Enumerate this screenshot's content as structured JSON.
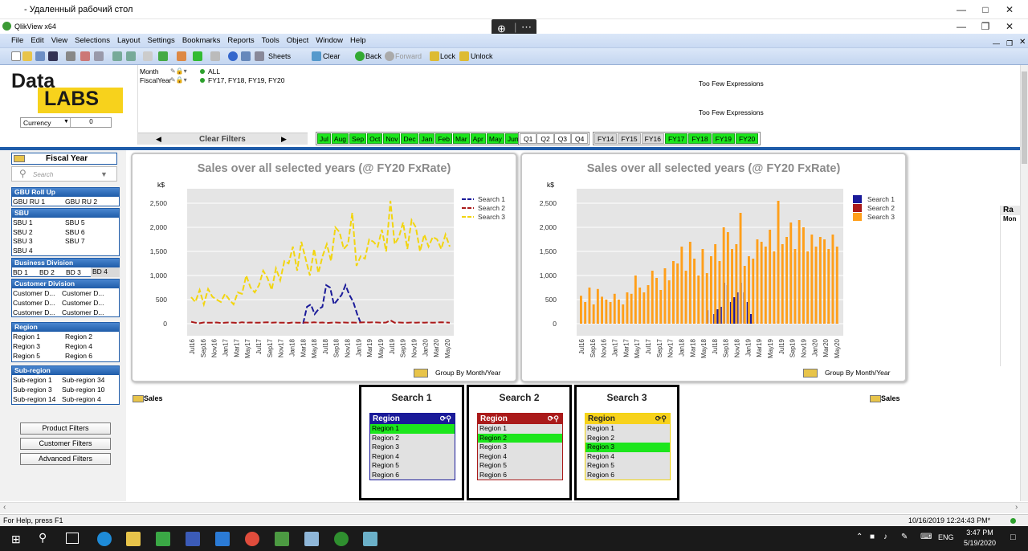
{
  "rdp": {
    "title": " - Удаленный рабочий стол"
  },
  "app": {
    "title": "QlikView x64"
  },
  "menu": [
    "File",
    "Edit",
    "View",
    "Selections",
    "Layout",
    "Settings",
    "Bookmarks",
    "Reports",
    "Tools",
    "Object",
    "Window",
    "Help"
  ],
  "toolbar": {
    "sheets": "Sheets",
    "clear": "Clear",
    "back": "Back",
    "forward": "Forward",
    "lock": "Lock",
    "unlock": "Unlock"
  },
  "logo": {
    "top": "Data",
    "bottom": "LABS"
  },
  "currency": {
    "label": "Currency",
    "value": "0"
  },
  "current_selections": [
    {
      "field": "Month",
      "value": "ALL"
    },
    {
      "field": "FiscalYear",
      "value": "FY17, FY18, FY19, FY20"
    }
  ],
  "clear_filters": "Clear Filters",
  "too_few": [
    "Too Few Expressions",
    "Too Few Expressions"
  ],
  "months": [
    "Jul",
    "Aug",
    "Sep",
    "Oct",
    "Nov",
    "Dec",
    "Jan",
    "Feb",
    "Mar",
    "Apr",
    "May",
    "Jun"
  ],
  "quarters": [
    "Q1",
    "Q2",
    "Q3",
    "Q4"
  ],
  "fiscal_years": [
    "FY14",
    "FY15",
    "FY16",
    "FY17",
    "FY18",
    "FY19",
    "FY20"
  ],
  "left": {
    "fiscal_year_title": "Fiscal Year",
    "search_placeholder": "Search",
    "gbu": {
      "title": "GBU Roll Up",
      "items": [
        "GBU RU 1",
        "GBU RU 2"
      ]
    },
    "sbu": {
      "title": "SBU",
      "items": [
        "SBU 1",
        "SBU 5",
        "SBU 2",
        "SBU 6",
        "SBU 3",
        "SBU 7",
        "SBU 4"
      ]
    },
    "bd": {
      "title": "Business Division",
      "items": [
        "BD 1",
        "BD 2",
        "BD 3",
        "BD 4"
      ]
    },
    "cd": {
      "title": "Customer Division",
      "items": [
        "Customer D...",
        "Customer D...",
        "Customer D...",
        "Customer D...",
        "Customer D...",
        "Customer D..."
      ]
    },
    "region": {
      "title": "Region",
      "items": [
        "Region 1",
        "Region 2",
        "Region 3",
        "Region 4",
        "Region 5",
        "Region 6"
      ]
    },
    "subregion": {
      "title": "Sub-region",
      "items": [
        "Sub-region 1",
        "Sub-region 34",
        "Sub-region 3",
        "Sub-region 10",
        "Sub-region 14",
        "Sub-region 4"
      ]
    },
    "buttons": [
      "Product Filters",
      "Customer Filters",
      "Advanced Filters"
    ]
  },
  "charts": {
    "title": "Sales over all selected years (@ FY20 FxRate)",
    "unit": "k$",
    "group_by": "Group By Month/Year",
    "sales_label": "Sales",
    "colors": {
      "s1": "#1a1a99",
      "s2": "#aa1a1a",
      "s3_line": "#f2d50f",
      "s3_bar": "#ff9f1a"
    }
  },
  "chart_data": [
    {
      "type": "line",
      "title": "Sales over all selected years (@ FY20 FxRate)",
      "ylabel": "k$",
      "ylim": [
        -250,
        2800
      ],
      "yticks": [
        "2,500",
        "2,000",
        "1,500",
        "1,000",
        "500",
        "0"
      ],
      "xticklabels": [
        "Jul16",
        "Sep16",
        "Nov16",
        "Jan17",
        "Mar17",
        "May17",
        "Jul17",
        "Sep17",
        "Nov17",
        "Jan18",
        "Mar18",
        "May18",
        "Jul18",
        "Sep18",
        "Nov18",
        "Jan19",
        "Mar19",
        "May19",
        "Jul19",
        "Sep19",
        "Nov19",
        "Jan20",
        "Mar20",
        "May20"
      ],
      "series": [
        {
          "name": "Search 1",
          "values": [
            0,
            0,
            0,
            0,
            0,
            0,
            0,
            0,
            0,
            0,
            0,
            0,
            0,
            0,
            0,
            0,
            0,
            0,
            0,
            0,
            0,
            0,
            0,
            0,
            0,
            0,
            0,
            0,
            0,
            0,
            350,
            400,
            200,
            300,
            350,
            800,
            750,
            400,
            500,
            600,
            800,
            600,
            450,
            200,
            0,
            0,
            0,
            0,
            0,
            0,
            0,
            0,
            0,
            0,
            0,
            0,
            0,
            0,
            0,
            0,
            0,
            0,
            0,
            0,
            0,
            0,
            0,
            0
          ]
        },
        {
          "name": "Search 2",
          "values": [
            40,
            20,
            10,
            25,
            20,
            20,
            25,
            15,
            20,
            25,
            20,
            15,
            30,
            20,
            25,
            20,
            20,
            25,
            30,
            20,
            25,
            20,
            20,
            15,
            25,
            20,
            20,
            25,
            20,
            30,
            20,
            25,
            15,
            20,
            25,
            20,
            25,
            20,
            25,
            20,
            25,
            30,
            25,
            30,
            25,
            20,
            25,
            70,
            20,
            25,
            20,
            20,
            25,
            20,
            25,
            20,
            25,
            20,
            25,
            30,
            25,
            20
          ]
        },
        {
          "name": "Search 3",
          "values": [
            550,
            450,
            700,
            400,
            720,
            560,
            500,
            450,
            620,
            500,
            400,
            650,
            620,
            1000,
            750,
            650,
            800,
            1100,
            950,
            700,
            1150,
            900,
            1300,
            1250,
            1600,
            1100,
            1700,
            1350,
            1000,
            1550,
            1050,
            1400,
            1650,
            1300,
            2000,
            1900,
            1550,
            1650,
            2300,
            1200,
            1400,
            1350,
            1750,
            1700,
            1600,
            1950,
            1500,
            2550,
            1650,
            1800,
            2100,
            1550,
            2150,
            2000,
            1500,
            1850,
            1600,
            1800,
            1750,
            1550,
            1850,
            1600
          ]
        }
      ]
    },
    {
      "type": "bar",
      "title": "Sales over all selected years (@ FY20 FxRate)",
      "ylabel": "k$",
      "ylim": [
        -250,
        2800
      ],
      "yticks": [
        "2,500",
        "2,000",
        "1,500",
        "1,000",
        "500",
        "0"
      ],
      "xticklabels": [
        "Jul16",
        "Sep16",
        "Nov16",
        "Jan17",
        "Mar17",
        "May17",
        "Jul17",
        "Sep17",
        "Nov17",
        "Jan18",
        "Mar18",
        "May18",
        "Jul18",
        "Sep18",
        "Nov18",
        "Jan19",
        "Mar19",
        "May19",
        "Jul19",
        "Sep19",
        "Nov19",
        "Jan20",
        "Mar20",
        "May20"
      ],
      "series": [
        {
          "name": "Search 1",
          "values": [
            0,
            0,
            0,
            0,
            0,
            0,
            0,
            0,
            0,
            0,
            0,
            0,
            0,
            0,
            0,
            0,
            0,
            0,
            0,
            0,
            0,
            0,
            0,
            0,
            0,
            0,
            0,
            0,
            0,
            0,
            0,
            0,
            0,
            0,
            0,
            0,
            0,
            0,
            280,
            380,
            200,
            300,
            350,
            850,
            800,
            450,
            550,
            650,
            850,
            650,
            450,
            200,
            0,
            0,
            0,
            0,
            0,
            0,
            0,
            0,
            0,
            0,
            0,
            0,
            0,
            0,
            0,
            0,
            0,
            0,
            0,
            0,
            0,
            0,
            0,
            0,
            0,
            0
          ]
        },
        {
          "name": "Search 2",
          "values": [
            40,
            20,
            10,
            25,
            20,
            20,
            25,
            15,
            20,
            25,
            20,
            15,
            30,
            20,
            25,
            20,
            20,
            25,
            30,
            20,
            25,
            20,
            20,
            15,
            25,
            20,
            20,
            25,
            20,
            30,
            20,
            25,
            15,
            20,
            25,
            20,
            25,
            20,
            25,
            20,
            25,
            30,
            25,
            30,
            25,
            20,
            25,
            60,
            20,
            25,
            20,
            20,
            25,
            20,
            25,
            20,
            25,
            20,
            25,
            30,
            25,
            20
          ]
        },
        {
          "name": "Search 3",
          "values": [
            580,
            450,
            750,
            400,
            720,
            560,
            500,
            450,
            620,
            500,
            400,
            650,
            620,
            1000,
            750,
            650,
            800,
            1100,
            950,
            700,
            1150,
            900,
            1300,
            1250,
            1600,
            1100,
            1700,
            1350,
            1000,
            1550,
            1050,
            1400,
            1650,
            1300,
            2000,
            1900,
            1550,
            1650,
            2300,
            1200,
            1400,
            1350,
            1750,
            1700,
            1600,
            1950,
            1500,
            2550,
            1650,
            1800,
            2100,
            1550,
            2150,
            2000,
            1500,
            1850,
            1600,
            1800,
            1750,
            1550,
            1850,
            1600
          ]
        }
      ]
    }
  ],
  "searches": [
    {
      "title": "Search 1",
      "list_title": "Region",
      "selected": 0,
      "items": [
        "Region 1",
        "Region 2",
        "Region 3",
        "Region 4",
        "Region 5",
        "Region 6"
      ]
    },
    {
      "title": "Search 2",
      "list_title": "Region",
      "selected": 1,
      "items": [
        "Region 1",
        "Region 2",
        "Region 3",
        "Region 4",
        "Region 5",
        "Region 6"
      ]
    },
    {
      "title": "Search 3",
      "list_title": "Region",
      "selected": 2,
      "items": [
        "Region 1",
        "Region 2",
        "Region 3",
        "Region 4",
        "Region 5",
        "Region 6"
      ]
    }
  ],
  "right_edge": {
    "top": "Ra",
    "bottom": "Mon"
  },
  "status": {
    "help": "For Help, press F1",
    "timestamp": "10/16/2019 12:24:43 PM*"
  },
  "taskbar": {
    "lang": "ENG",
    "time": "3:47 PM",
    "date": "5/19/2020"
  }
}
